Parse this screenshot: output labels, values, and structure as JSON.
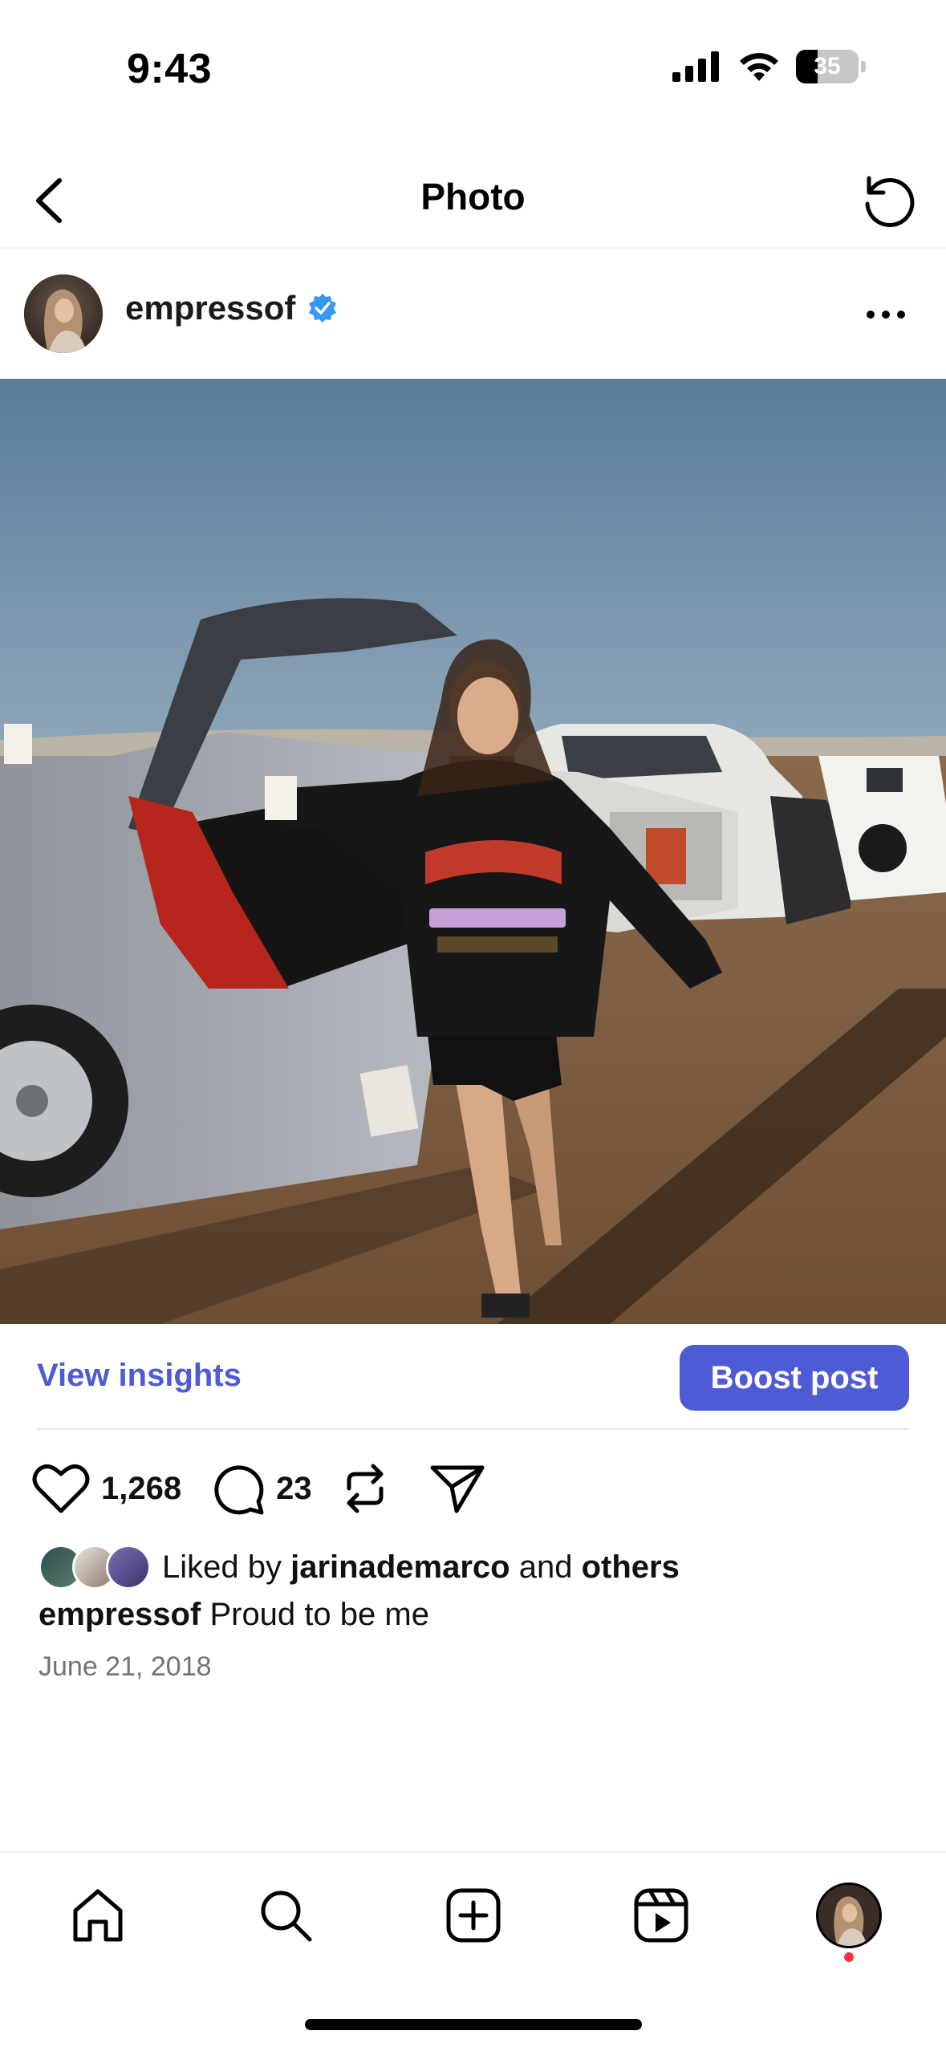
{
  "status_bar": {
    "time": "9:43",
    "battery_level": "35",
    "icons": [
      "cellular-signal-icon",
      "wifi-icon",
      "battery-icon"
    ]
  },
  "nav": {
    "title": "Photo",
    "back_icon": "chevron-left-icon",
    "refresh_icon": "refresh-icon"
  },
  "post": {
    "username": "empressof",
    "verified": true,
    "more_icon": "more-horizontal-icon",
    "photo_description_icon": "photo"
  },
  "insights": {
    "view_insights_label": "View insights",
    "boost_label": "Boost post"
  },
  "actions": {
    "likes": "1,268",
    "comments": "23",
    "icons": [
      "heart-icon",
      "comment-icon",
      "repost-icon",
      "share-icon"
    ]
  },
  "liked_by": {
    "prefix": "Liked by",
    "user": "jarinademarco",
    "conj": "and",
    "rest": "others"
  },
  "caption": {
    "username": "empressof",
    "text": "Proud to be me"
  },
  "date": "June 21, 2018",
  "tab_bar": {
    "items": [
      "home-icon",
      "search-icon",
      "create-icon",
      "reels-icon",
      "profile-avatar"
    ]
  },
  "colors": {
    "accent": "#4f5bd5",
    "verified": "#3897f0",
    "notification": "#ff3040",
    "divider": "#e5e5e5",
    "muted_text": "#737373"
  }
}
